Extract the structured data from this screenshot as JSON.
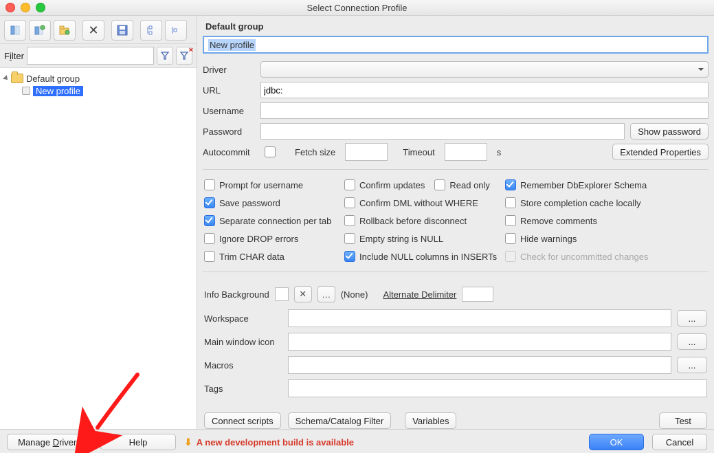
{
  "window": {
    "title": "Select Connection Profile"
  },
  "left": {
    "filter_label_pre": "F",
    "filter_label_und": "i",
    "filter_label_post": "lter",
    "tree": {
      "group": "Default group",
      "profile": "New profile"
    }
  },
  "right": {
    "group_header": "Default group",
    "profile_name": "New profile",
    "labels": {
      "driver": "Driver",
      "url": "URL",
      "username": "Username",
      "password": "Password",
      "autocommit": "Autocommit",
      "fetch_size": "Fetch size",
      "timeout": "Timeout",
      "timeout_unit": "s"
    },
    "values": {
      "url": "jdbc:"
    },
    "buttons": {
      "show_password": "Show password",
      "extended_props": "Extended Properties",
      "connect_scripts": "Connect scripts",
      "schema_filter": "Schema/Catalog Filter",
      "variables": "Variables",
      "test": "Test"
    },
    "checks": {
      "c00": "Prompt for username",
      "c01": "Confirm updates",
      "c01b": "Read only",
      "c02": "Remember DbExplorer Schema",
      "c10": "Save password",
      "c11": "Confirm DML without WHERE",
      "c12": "Store completion cache locally",
      "c20": "Separate connection per tab",
      "c21": "Rollback before disconnect",
      "c22": "Remove comments",
      "c30": "Ignore DROP errors",
      "c31": "Empty string is NULL",
      "c32": "Hide warnings",
      "c40": "Trim CHAR data",
      "c41": "Include NULL columns in INSERTs",
      "c42": "Check for uncommitted changes"
    },
    "info": {
      "label": "Info Background",
      "none": "(None)",
      "alt_delim": "Alternate Delimiter"
    },
    "paths": {
      "workspace": "Workspace",
      "main_icon": "Main window icon",
      "macros": "Macros",
      "tags": "Tags",
      "ellipsis": "..."
    }
  },
  "footer": {
    "manage_drivers": "Manage Drivers",
    "help": "Help",
    "alert": "A new development build is available",
    "ok": "OK",
    "cancel": "Cancel"
  }
}
